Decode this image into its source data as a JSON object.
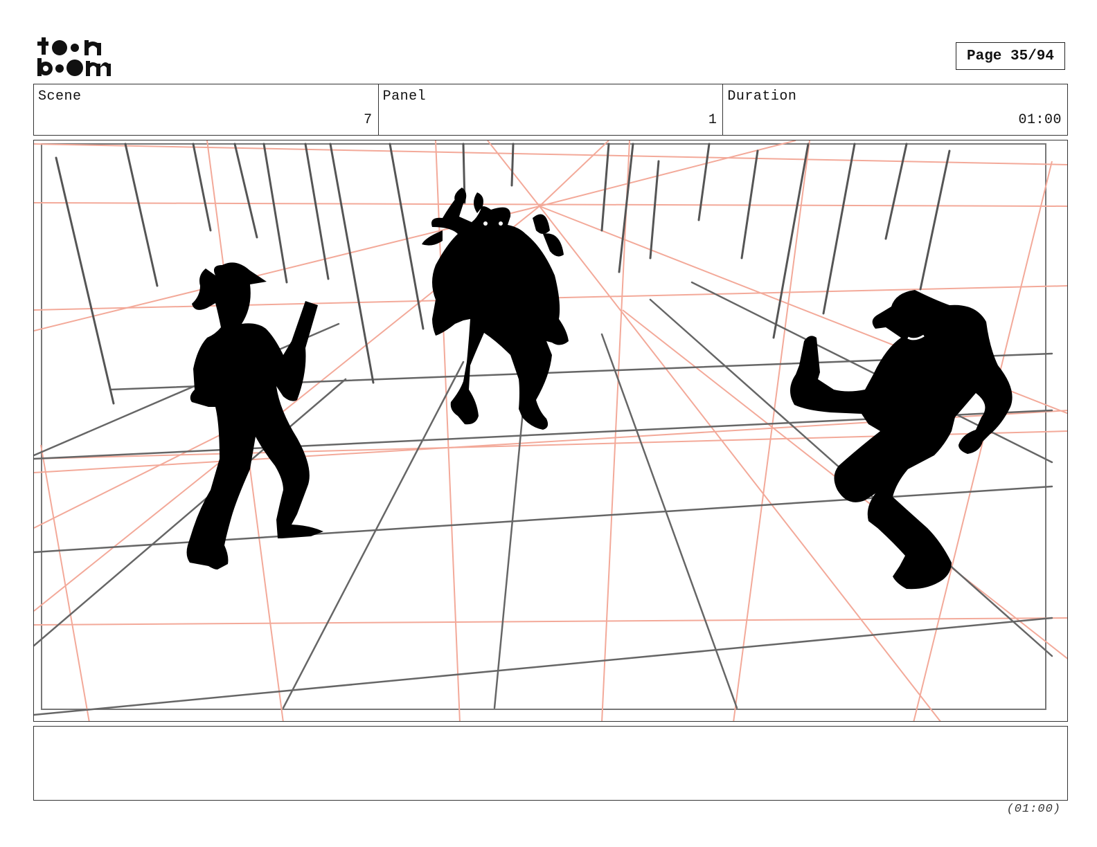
{
  "logo": {
    "line1": "toon",
    "line2": "boom"
  },
  "page_label": "Page 35/94",
  "header": {
    "scene_label": "Scene",
    "scene_value": "7",
    "panel_label": "Panel",
    "panel_value": "1",
    "duration_label": "Duration",
    "duration_value": "01:00"
  },
  "footer_duration": "(01:00)",
  "colors": {
    "perspective": "#f3a999",
    "pencil": "#666666",
    "silhouette": "#000000"
  }
}
